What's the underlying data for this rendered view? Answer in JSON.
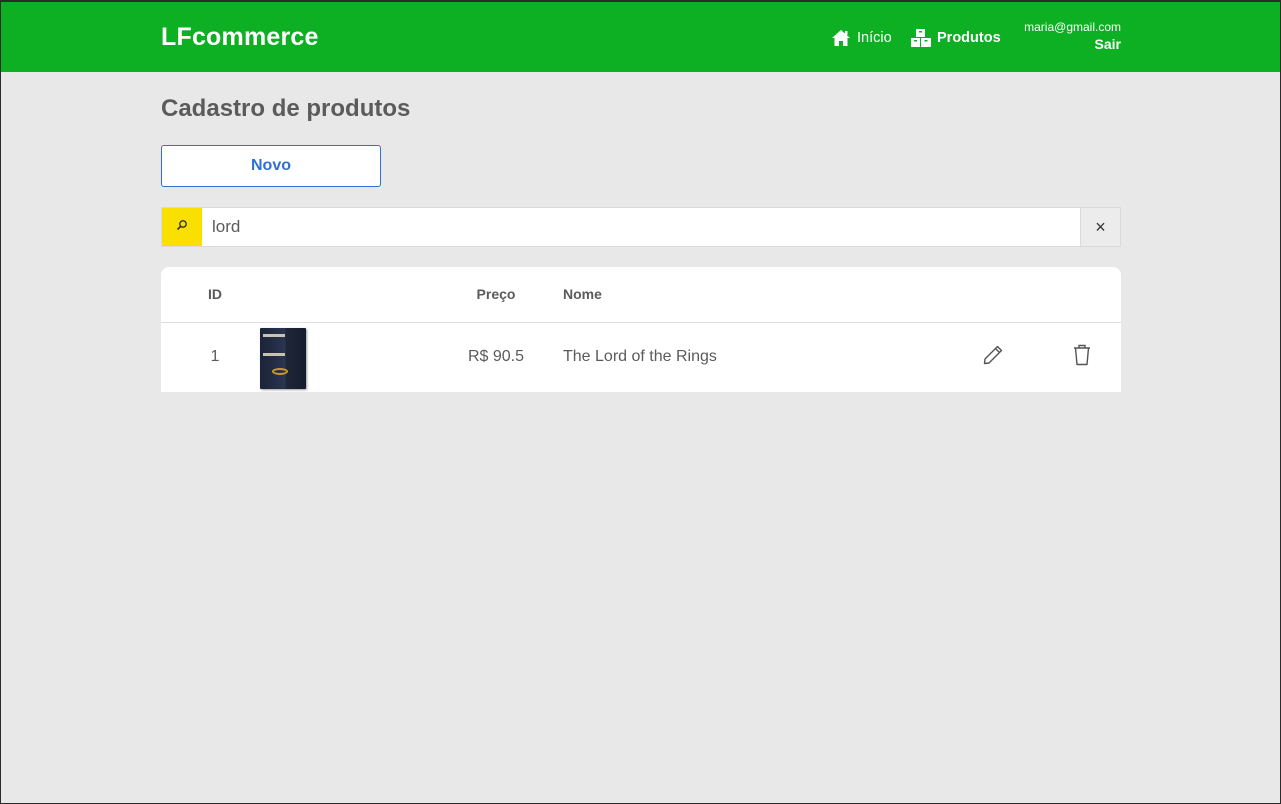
{
  "header": {
    "brand": "LFcommerce",
    "nav": {
      "home_label": "Início",
      "products_label": "Produtos"
    },
    "user": {
      "email": "maria@gmail.com",
      "logout_label": "Sair"
    }
  },
  "page": {
    "title": "Cadastro de produtos",
    "new_button_label": "Novo"
  },
  "search": {
    "value": "lord",
    "clear_symbol": "×"
  },
  "table": {
    "headers": {
      "id": "ID",
      "price": "Preço",
      "name": "Nome"
    },
    "rows": [
      {
        "id": "1",
        "image": "book-cover-lord-of-the-rings",
        "price": "R$ 90.5",
        "name": "The Lord of the Rings"
      }
    ]
  },
  "colors": {
    "header_bg": "#0db022",
    "page_bg": "#e8e8e8",
    "accent_blue": "#2f6fd6",
    "search_addon": "#f9e000"
  },
  "icons": [
    "home-icon",
    "boxes-icon",
    "search-icon",
    "close-icon",
    "pencil-icon",
    "trash-icon"
  ]
}
